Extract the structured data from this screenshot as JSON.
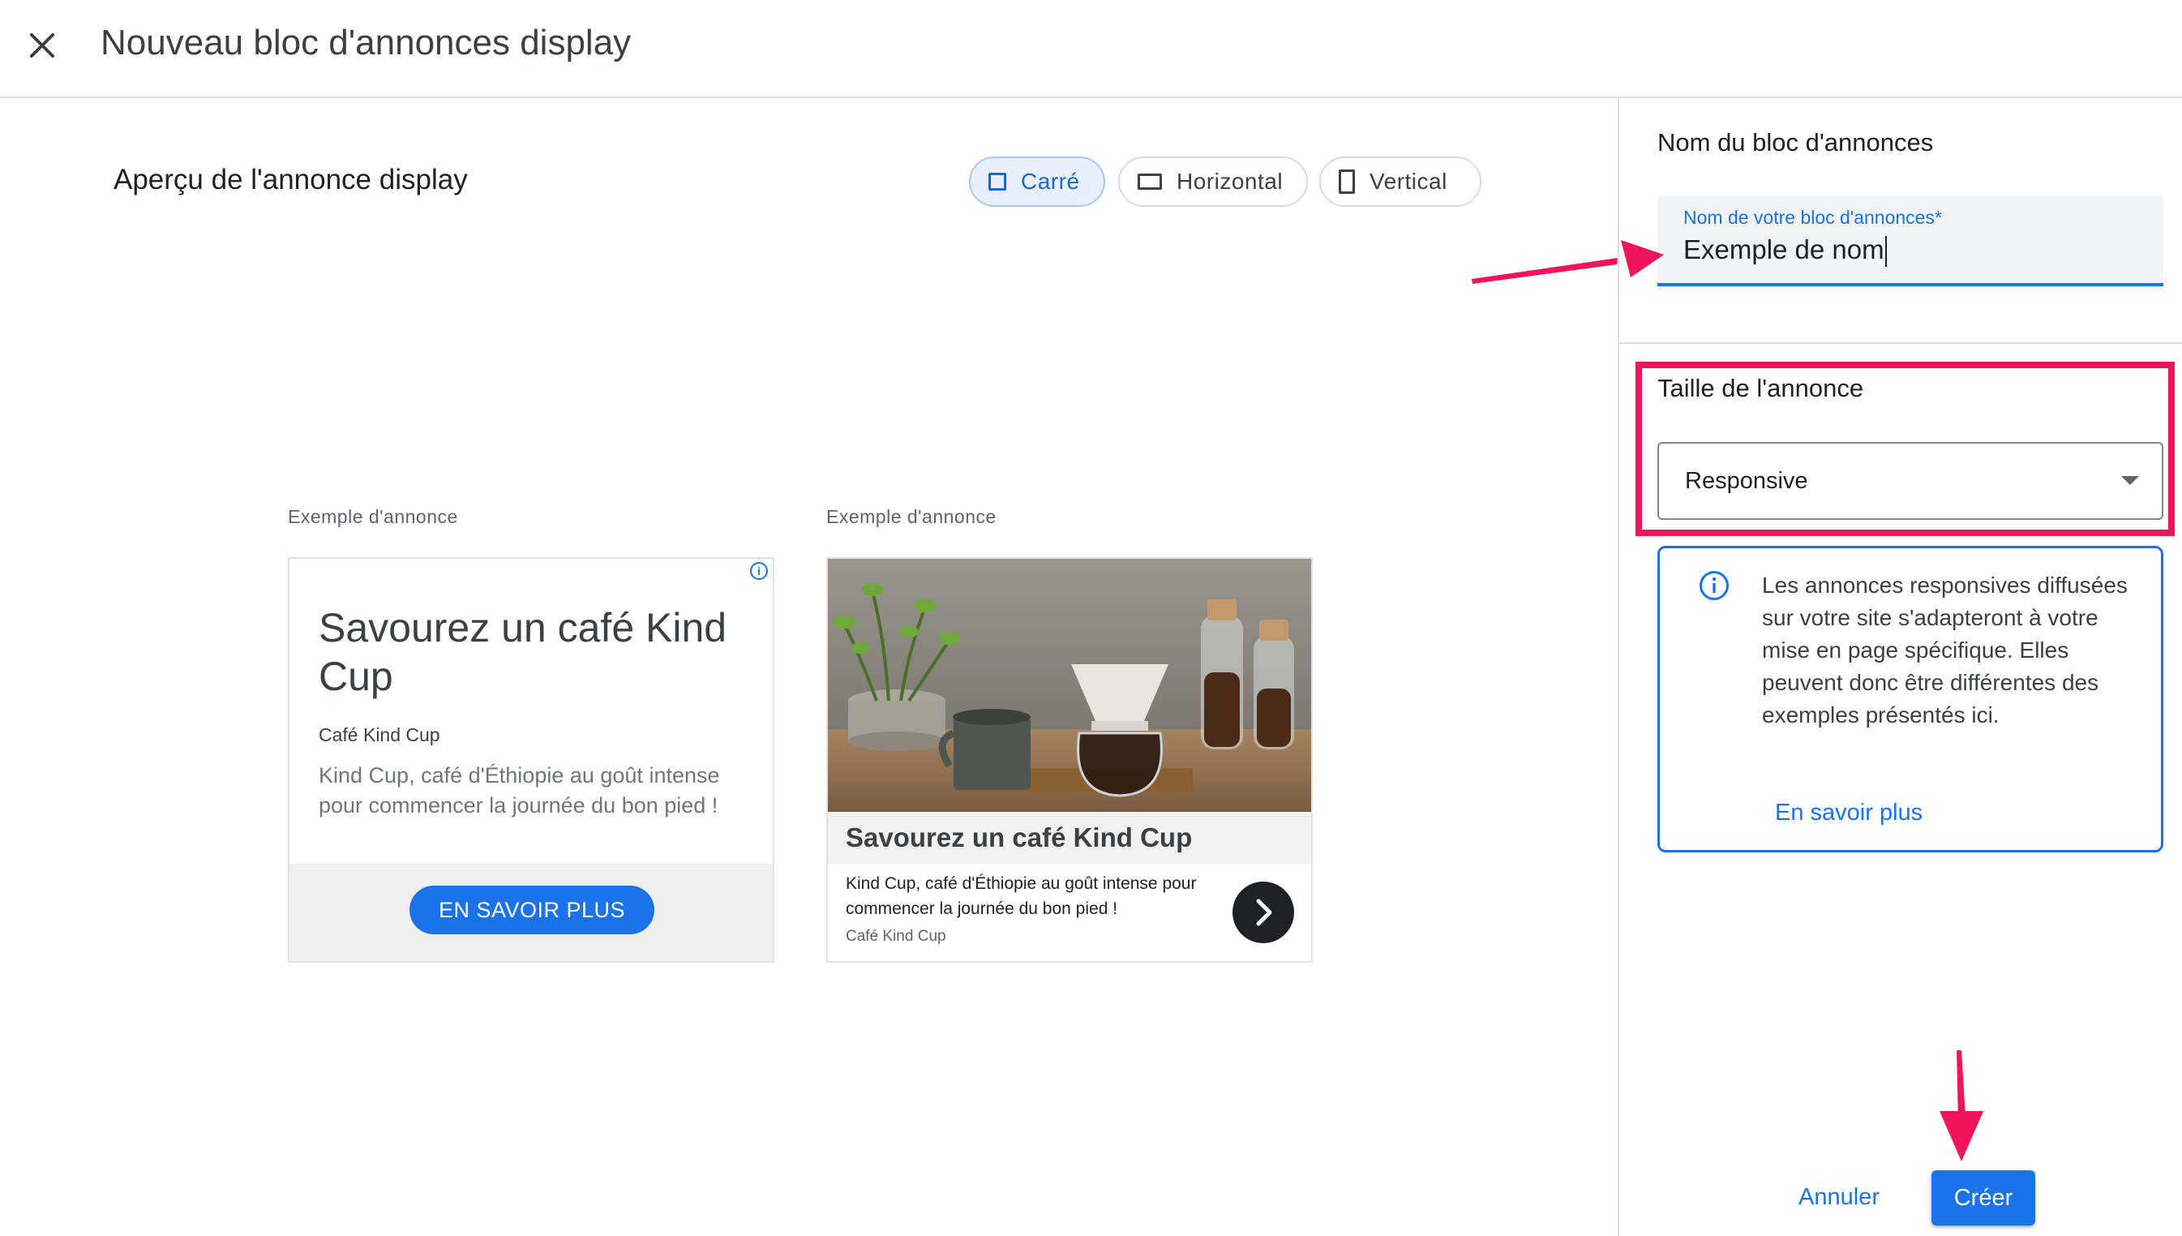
{
  "header": {
    "title": "Nouveau bloc d'annonces display",
    "close_icon": "close-icon"
  },
  "preview": {
    "title": "Aperçu de l'annonce display",
    "formats": [
      {
        "label": "Carré",
        "icon": "square-icon",
        "selected": true
      },
      {
        "label": "Horizontal",
        "icon": "landscape-rectangle-icon",
        "selected": false
      },
      {
        "label": "Vertical",
        "icon": "portrait-rectangle-icon",
        "selected": false
      }
    ],
    "ads": [
      {
        "label": "Exemple d'annonce",
        "headline": "Savourez un café Kind Cup",
        "brand": "Café Kind Cup",
        "description": "Kind Cup, café d'Éthiopie au goût intense pour commencer la journée du bon pied !",
        "cta": "EN SAVOIR PLUS",
        "badge_icon": "ad-info-icon"
      },
      {
        "label": "Exemple d'annonce",
        "image": "coffee-photo",
        "headline": "Savourez un café Kind Cup",
        "description": "Kind Cup, café d'Éthiopie au goût intense pour commencer la journée du bon pied !",
        "brand": "Café Kind Cup",
        "arrow_icon": "chevron-right-icon"
      }
    ]
  },
  "settings": {
    "name_section_title": "Nom du bloc d'annonces",
    "name_field": {
      "label": "Nom de votre bloc d'annonces*",
      "value": "Exemple de nom"
    },
    "size_section_title": "Taille de l'annonce",
    "size_select": {
      "value": "Responsive"
    },
    "info": {
      "icon": "info-icon",
      "text": "Les annonces responsives diffusées sur votre site s'adapteront à votre mise en page spécifique. Elles peuvent donc être différentes des exemples présentés ici.",
      "link": "En savoir plus"
    }
  },
  "footer": {
    "cancel_label": "Annuler",
    "create_label": "Créer"
  },
  "colors": {
    "accent": "#1a73e8",
    "annotation": "#f0145a"
  }
}
